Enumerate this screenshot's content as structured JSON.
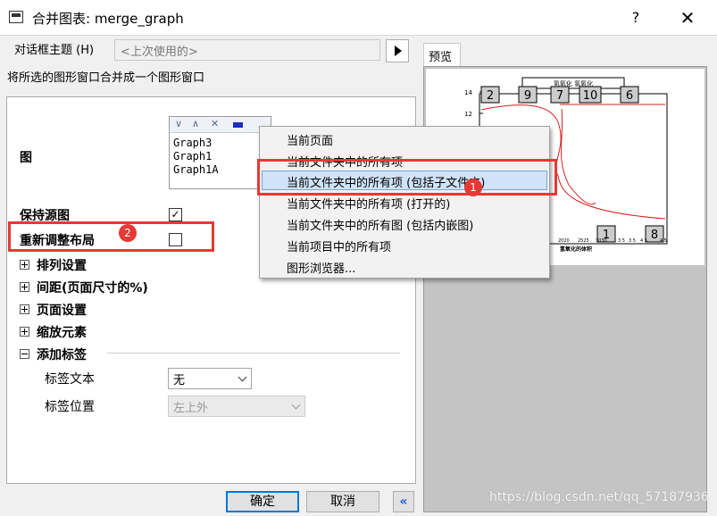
{
  "window": {
    "title": "合并图表: merge_graph",
    "help": "?",
    "close": "✕"
  },
  "theme": {
    "label": "对话框主题 (H)",
    "value": "<上次使用的>"
  },
  "description": "将所选的图形窗口合并成一个图形窗口",
  "graphs": {
    "label": "图",
    "items": [
      "Graph3",
      "Graph1",
      "Graph1A"
    ]
  },
  "keep_source": {
    "label": "保持源图",
    "checked": true
  },
  "rearrange": {
    "label": "重新调整布局",
    "checked": false
  },
  "sections": [
    {
      "label": "排列设置",
      "expanded": false
    },
    {
      "label": "间距(页面尺寸的%)",
      "expanded": false
    },
    {
      "label": "页面设置",
      "expanded": false
    },
    {
      "label": "缩放元素",
      "expanded": false
    },
    {
      "label": "添加标签",
      "expanded": true
    }
  ],
  "label_text": {
    "label": "标签文本",
    "value": "无"
  },
  "label_pos": {
    "label": "标签位置",
    "value": "左上外"
  },
  "buttons": {
    "ok": "确定",
    "cancel": "取消",
    "collapse": "«"
  },
  "preview": {
    "tab": "预览",
    "y_ticks": [
      "14",
      "12"
    ],
    "x_ticks": [
      "2020",
      "2525",
      "3030",
      "3 5",
      "3 5",
      "4 5",
      "4 5"
    ],
    "x_title": "氢氧化的体积",
    "legend": "氢氧化 氢氧化",
    "markers_top": [
      "2",
      "9",
      "7",
      "10",
      "6"
    ],
    "markers_bottom": [
      "1",
      "8"
    ]
  },
  "menu": {
    "items": [
      "当前页面",
      "当前文件夹中的所有项",
      "当前文件夹中的所有项 (包括子文件夹)",
      "当前文件夹中的所有项 (打开的)",
      "当前文件夹中的所有图 (包括内嵌图)",
      "当前项目中的所有项",
      "图形浏览器..."
    ],
    "highlighted_index": 2
  },
  "annotations": {
    "badge1": "1",
    "badge2": "2",
    "accent": "#e53935"
  },
  "watermark": "https://blog.csdn.net/qq_57187936"
}
